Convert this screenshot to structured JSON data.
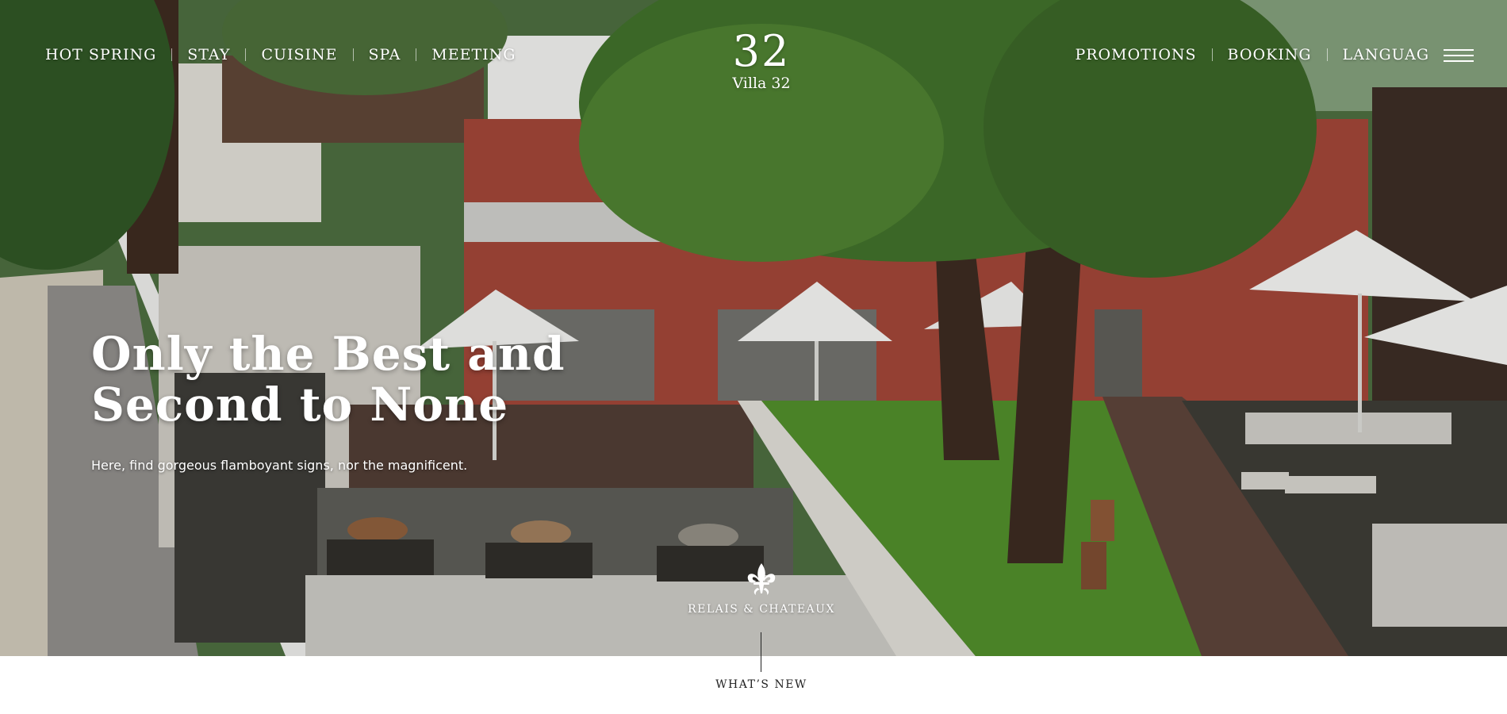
{
  "nav_left": [
    {
      "label": "HOT SPRING"
    },
    {
      "label": "STAY"
    },
    {
      "label": "CUISINE"
    },
    {
      "label": "SPA"
    },
    {
      "label": "MEETING"
    }
  ],
  "nav_right": [
    {
      "label": "PROMOTIONS"
    },
    {
      "label": "BOOKING"
    },
    {
      "label": "LANGUAG"
    }
  ],
  "brand": {
    "number": "32",
    "name": "Villa 32"
  },
  "hero": {
    "headline_line1": "Only the Best and",
    "headline_line2": "Second to None",
    "subtitle": "Here, find gorgeous flamboyant signs, nor the magnificent."
  },
  "affiliation": {
    "label": "RELAIS & CHATEAUX"
  },
  "whats_new": {
    "label": "WHAT’S NEW"
  },
  "icons": {
    "menu": "hamburger-menu-icon",
    "affiliation": "fleur-de-lis-icon"
  }
}
